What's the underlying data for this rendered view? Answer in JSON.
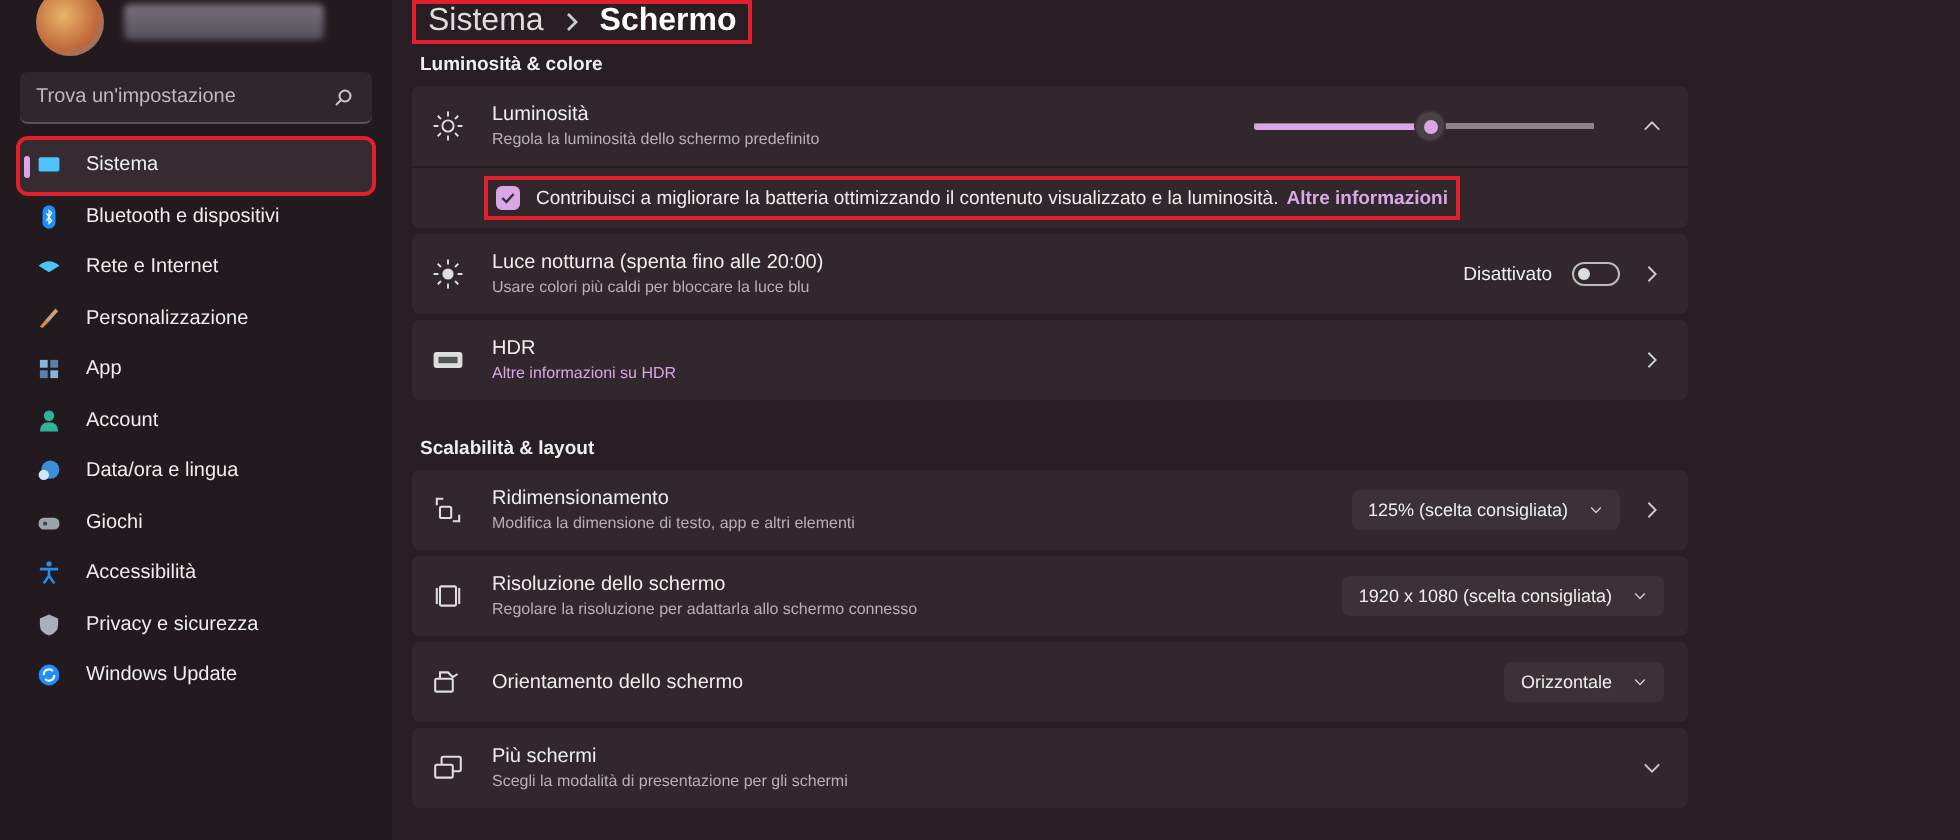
{
  "sidebar": {
    "search": {
      "placeholder": "Trova un'impostazione"
    },
    "items": [
      {
        "label": "Sistema",
        "selected": true,
        "highlighted": true
      },
      {
        "label": "Bluetooth e dispositivi",
        "selected": false,
        "highlighted": false
      },
      {
        "label": "Rete e Internet",
        "selected": false,
        "highlighted": false
      },
      {
        "label": "Personalizzazione",
        "selected": false,
        "highlighted": false
      },
      {
        "label": "App",
        "selected": false,
        "highlighted": false
      },
      {
        "label": "Account",
        "selected": false,
        "highlighted": false
      },
      {
        "label": "Data/ora e lingua",
        "selected": false,
        "highlighted": false
      },
      {
        "label": "Giochi",
        "selected": false,
        "highlighted": false
      },
      {
        "label": "Accessibilità",
        "selected": false,
        "highlighted": false
      },
      {
        "label": "Privacy e sicurezza",
        "selected": false,
        "highlighted": false
      },
      {
        "label": "Windows Update",
        "selected": false,
        "highlighted": false
      }
    ]
  },
  "breadcrumb": {
    "items": [
      "Sistema",
      "Schermo"
    ],
    "highlighted": true
  },
  "sections": [
    {
      "title": "Luminosità & colore",
      "rows": [
        {
          "kind": "slider",
          "title": "Luminosità",
          "subtitle": "Regola la luminosità dello schermo predefinito",
          "level": 0.52,
          "expanded": true,
          "option": {
            "checked": true,
            "highlighted": true,
            "text": "Contribuisci a migliorare la batteria ottimizzando il contenuto visualizzato e la luminosità.",
            "link": "Altre informazioni"
          }
        },
        {
          "kind": "toggle",
          "title": "Luce notturna (spenta fino alle 20:00)",
          "subtitle": "Usare colori più caldi per bloccare la luce blu",
          "status": "Disattivato",
          "on": false,
          "chevron": true
        },
        {
          "kind": "link",
          "title": "HDR",
          "subtitle": "Altre informazioni su HDR",
          "chevron": true
        }
      ]
    },
    {
      "title": "Scalabilità & layout",
      "rows": [
        {
          "kind": "dropdown",
          "title": "Ridimensionamento",
          "subtitle": "Modifica la dimensione di testo, app e altri elementi",
          "value": "125% (scelta consigliata)",
          "chevron": true
        },
        {
          "kind": "dropdown",
          "title": "Risoluzione dello schermo",
          "subtitle": "Regolare la risoluzione per adattarla allo schermo connesso",
          "value": "1920 x 1080 (scelta consigliata)",
          "chevron": false
        },
        {
          "kind": "dropdown",
          "title": "Orientamento dello schermo",
          "value": "Orizzontale",
          "chevron": false
        },
        {
          "kind": "expander",
          "title": "Più schermi",
          "subtitle": "Scegli la modalità di presentazione per gli schermi",
          "expanded": false
        }
      ]
    }
  ]
}
